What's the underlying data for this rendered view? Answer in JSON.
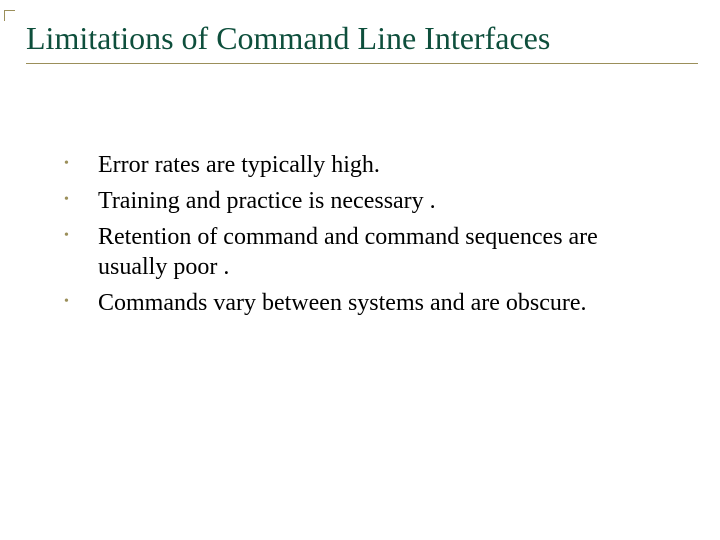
{
  "title": "Limitations of Command Line Interfaces",
  "bullets": [
    "Error rates are typically high.",
    "Training and practice is necessary .",
    "Retention of command and command sequences are usually poor .",
    "Commands vary between systems and are obscure."
  ]
}
